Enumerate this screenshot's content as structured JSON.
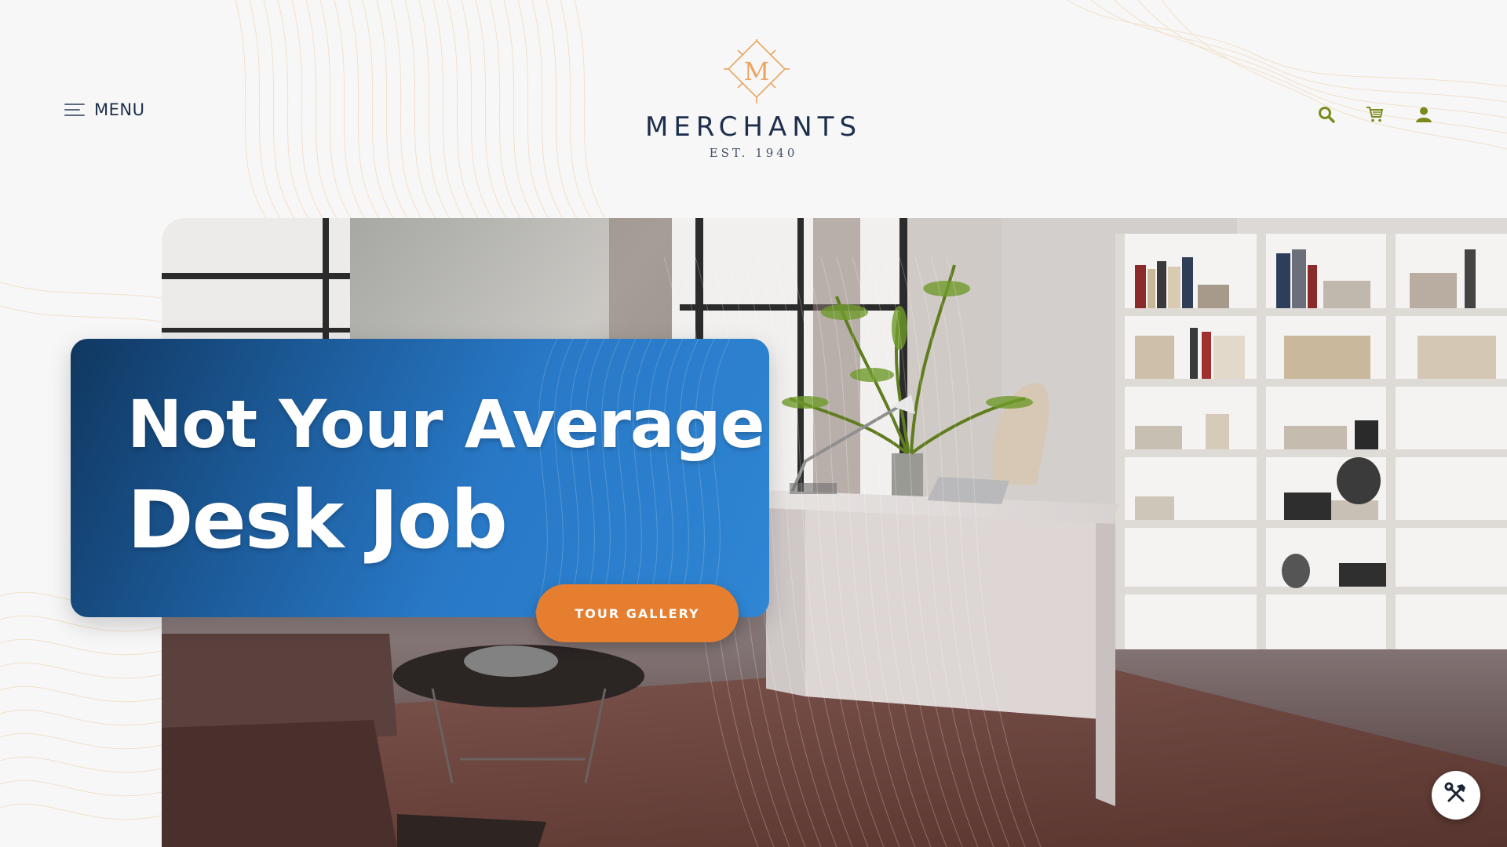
{
  "header": {
    "menu_label": "MENU",
    "logo": {
      "monogram": "M",
      "name": "MERCHANTS",
      "established": "EST. 1940"
    },
    "icons": [
      "search-icon",
      "cart-icon",
      "user-icon"
    ],
    "icon_color": "#7a8a1c"
  },
  "hero": {
    "headline_line1": "Not Your Average",
    "headline_line2": "Desk Job",
    "cta_label": "TOUR GALLERY",
    "card_color": "#2878c6",
    "cta_color": "#e67e2f"
  },
  "floating_tools": {
    "icon": "hammer-wrench-icon"
  }
}
